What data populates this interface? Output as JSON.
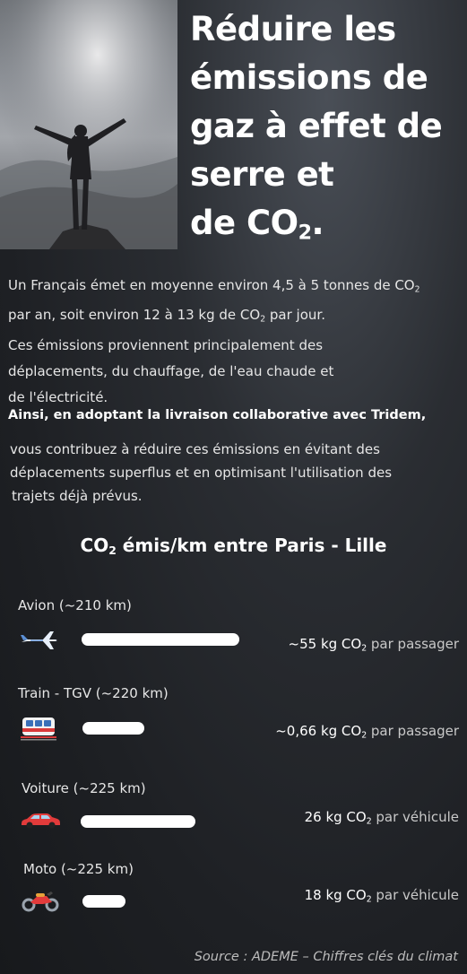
{
  "header": {
    "title_lines": [
      "Réduire les",
      "émissions de",
      "gaz à effet de",
      "serre et"
    ],
    "title_last_prefix": "de CO",
    "title_last_sub": "2",
    "title_last_suffix": "."
  },
  "intro": {
    "line1_a": "Un Français émet en moyenne environ 4,5 à 5 tonnes de CO",
    "line1_sub": "2",
    "line2_a": "par an, soit environ 12 à 13 kg de CO",
    "line2_sub": "2",
    "line2_b": " par jour.",
    "line3": "Ces émissions proviennent principalement des",
    "line4": "déplacements, du chauffage, de l'eau chaude et",
    "line5": "de l'électricité."
  },
  "highlight": "Ainsi, en adoptant la livraison collaborative avec Tridem,",
  "body2": {
    "line1": "vous contribuez à réduire ces émissions en évitant des",
    "line2": "déplacements superflus et en optimisant l'utilisation des",
    "line3": "trajets déjà prévus."
  },
  "chart_data": {
    "type": "bar",
    "title": "CO2 émis/km entre Paris - Lille",
    "title_prefix": "CO",
    "title_sub": "2",
    "title_suffix": " émis/km entre Paris - Lille",
    "categories": [
      "Avion (~210 km)",
      "Train - TGV (~220 km)",
      "Voiture (~225 km)",
      "Moto (~225 km)"
    ],
    "values": [
      55,
      0.66,
      26,
      18
    ],
    "bar_levels": [
      1.0,
      0.39,
      0.73,
      0.27
    ],
    "value_labels": [
      {
        "num": "~55 kg CO",
        "sub": "2",
        "unit": " par passager"
      },
      {
        "num": "~0,66 kg CO",
        "sub": "2",
        "unit": " par passager"
      },
      {
        "num": "26 kg CO",
        "sub": "2",
        "unit": " par véhicule"
      },
      {
        "num": "18 kg CO",
        "sub": "2",
        "unit": " par véhicule"
      }
    ],
    "icons": [
      "airplane-icon",
      "train-icon",
      "car-icon",
      "motorcycle-icon"
    ],
    "bar_color": "#ffffff"
  },
  "source": "Source : ADEME – Chiffres clés du climat"
}
